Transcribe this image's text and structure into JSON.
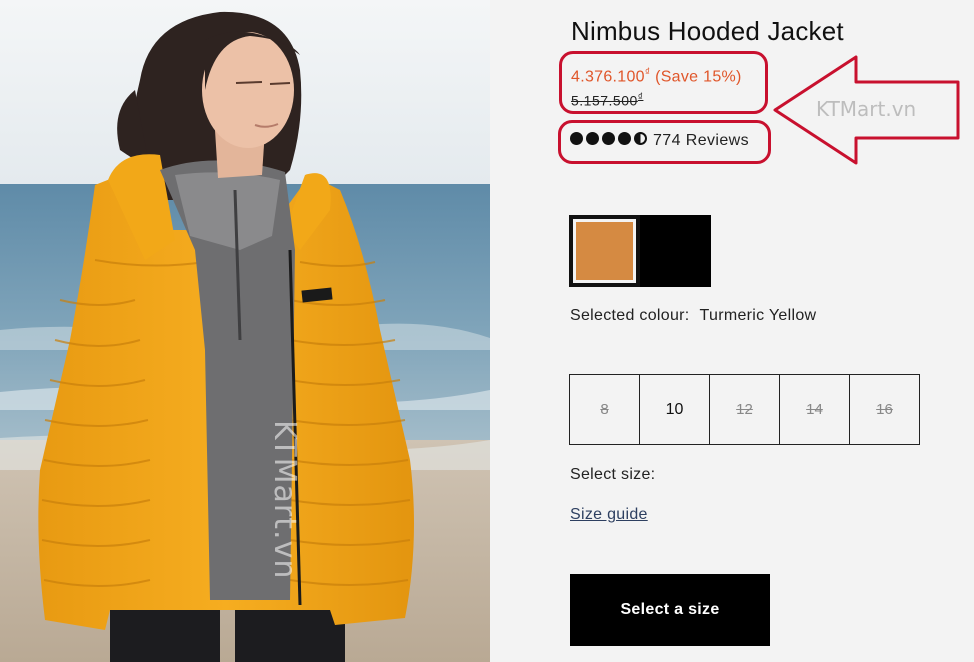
{
  "product": {
    "title": "Nimbus Hooded Jacket",
    "price": "4.376.100",
    "price_currency": "₫",
    "save_text": "(Save 15%)",
    "old_price": "5.157.500",
    "old_currency": "₫",
    "rating": 4.5,
    "reviews": "774 Reviews"
  },
  "watermark": {
    "side_text": "KTMart.vn",
    "arrow_text": "KTMart.vn"
  },
  "colours": [
    {
      "name": "Turmeric Yellow",
      "hex": "#d58a42",
      "selected": true
    },
    {
      "name": "Black",
      "hex": "#000000",
      "selected": false
    }
  ],
  "colour_selection": {
    "label": "Selected colour:",
    "value": "Turmeric Yellow"
  },
  "sizes": [
    {
      "label": "8",
      "available": false
    },
    {
      "label": "10",
      "available": true
    },
    {
      "label": "12",
      "available": false
    },
    {
      "label": "14",
      "available": false
    },
    {
      "label": "16",
      "available": false
    }
  ],
  "select_size_label": "Select size:",
  "size_guide_label": "Size guide",
  "cta_label": "Select a size",
  "colors": {
    "price_accent": "#e0562a",
    "highlight_red": "#c8102e",
    "jacket_yellow": "#f0a41c"
  }
}
